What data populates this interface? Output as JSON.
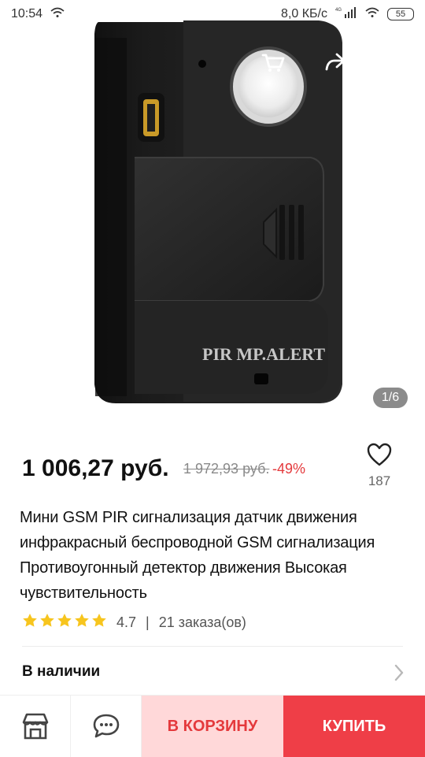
{
  "status": {
    "time": "10:54",
    "network_speed": "8,0 КБ/с",
    "battery": "55",
    "network_label": "4G"
  },
  "topbar": {
    "back_icon": "back-arrow-icon",
    "cart_icon": "cart-icon",
    "share_icon": "share-icon",
    "more_icon": "more-icon"
  },
  "product": {
    "image_counter": "1/6",
    "price": "1 006,27 руб.",
    "old_price": "1 972,93 руб.",
    "discount": "-49%",
    "wishlist_count": "187",
    "title": "Мини GSM PIR сигнализация датчик движения инфракрасный беспроводной GSM сигнализация Противоугонный детектор движения Высокая чувствительность",
    "rating": "4.7",
    "rating_separator": "|",
    "orders": "21 заказа(ов)",
    "availability": "В наличии",
    "device_label": "PIR MP.ALERT"
  },
  "actions": {
    "add_to_cart": "В КОРЗИНУ",
    "buy": "КУПИТЬ"
  },
  "colors": {
    "accent": "#ef3e47",
    "cart_bg": "#ffd8d9",
    "discount": "#e4393c",
    "star": "#f7c51e"
  }
}
